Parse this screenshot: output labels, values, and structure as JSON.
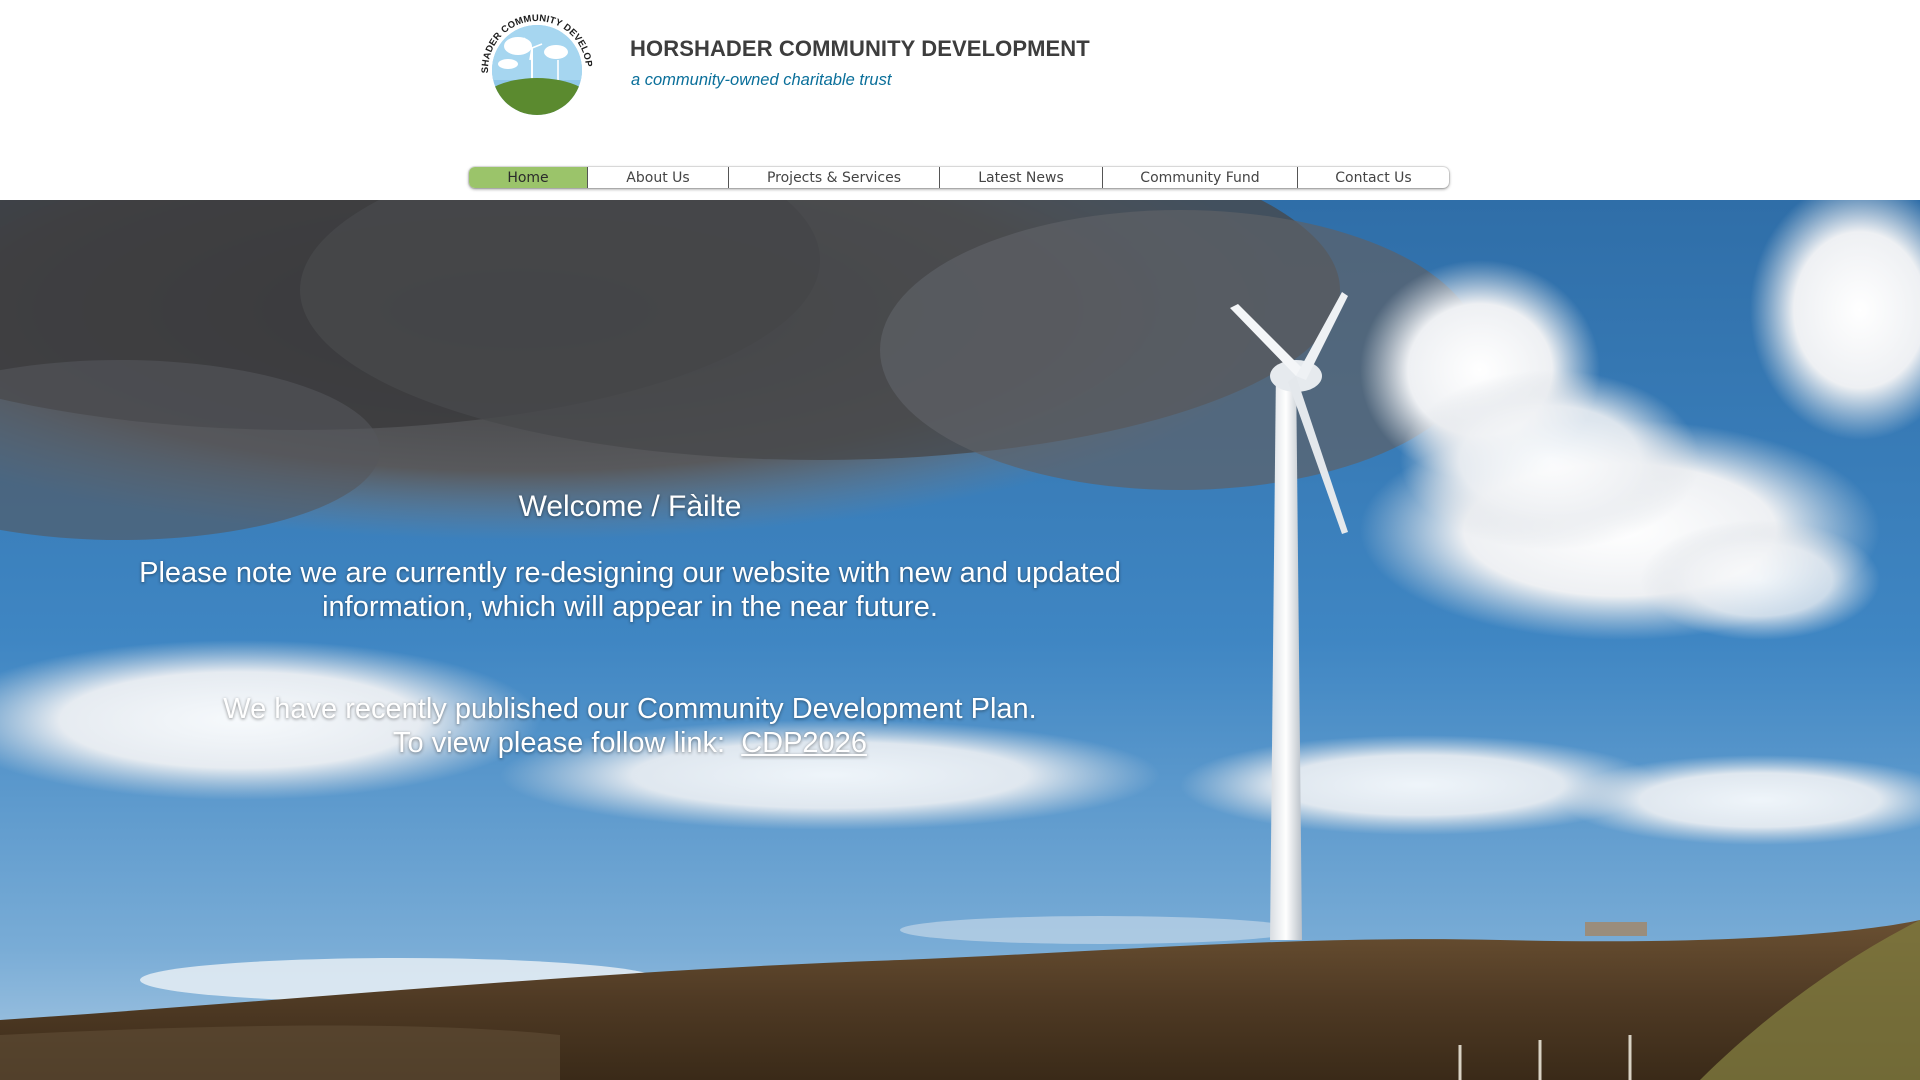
{
  "header": {
    "logo_text": "HORSHADER COMMUNITY DEVELOPMENT",
    "title": "HORSHADER COMMUNITY DEVELOPMENT",
    "tagline": "a community-owned charitable trust"
  },
  "nav": {
    "items": [
      {
        "label": "Home",
        "active": true
      },
      {
        "label": "About Us"
      },
      {
        "label": "Projects & Services"
      },
      {
        "label": "Latest News"
      },
      {
        "label": "Community Fund"
      },
      {
        "label": "Contact Us"
      }
    ]
  },
  "hero": {
    "welcome": "Welcome / Fàilte",
    "notice_line1": "Please note we are currently re-designing our website with new and updated",
    "notice_line2": "information, which will appear in the near future.",
    "plan_line1": "We have recently published our Community Development Plan.",
    "plan_line2_prefix": "To view please follow link:  ",
    "plan_link": "CDP2026"
  },
  "colors": {
    "nav_active": "#9bc46a",
    "title": "#3d3d3d",
    "tagline": "#0a6f9a",
    "sky": "#3f83c0",
    "hero_text": "#ffffff"
  },
  "icons": {
    "logo": "wind-turbine-logo"
  }
}
